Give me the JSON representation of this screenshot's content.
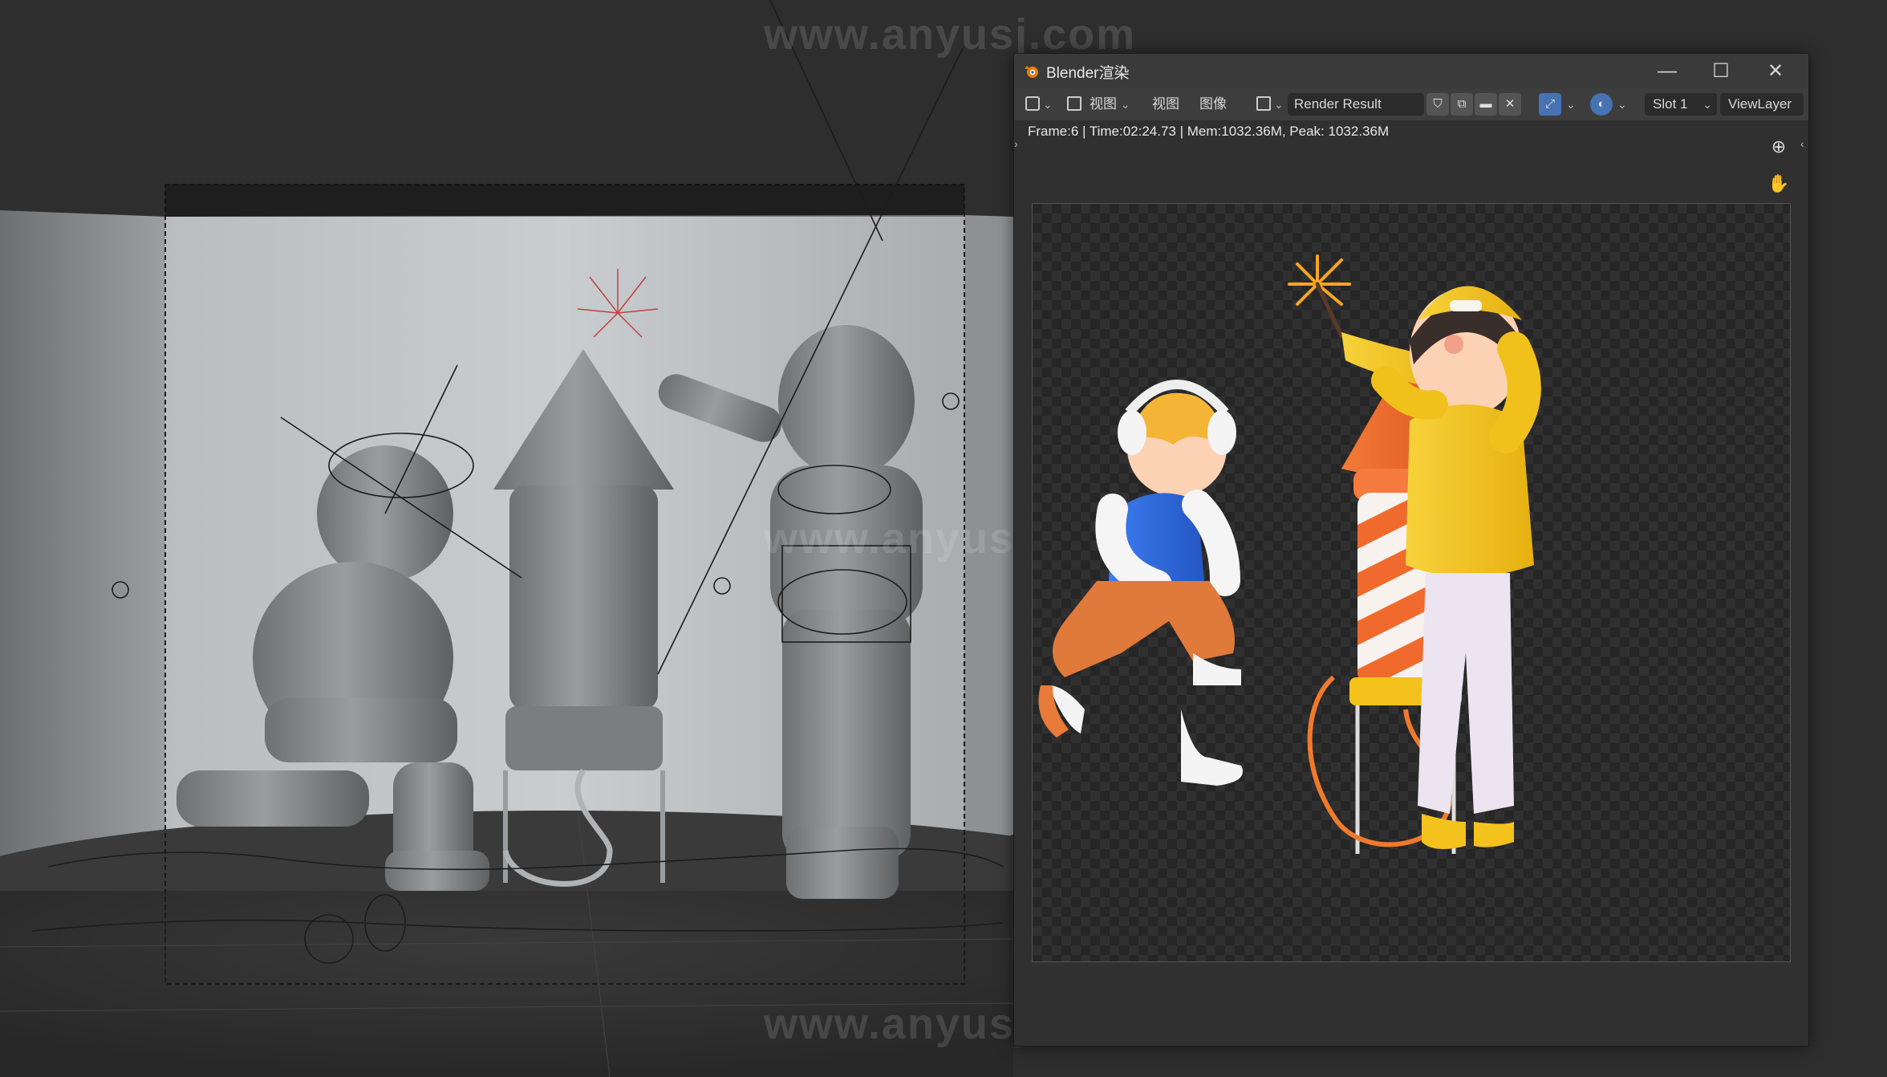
{
  "watermark": {
    "text": "www.anyusj.com"
  },
  "render_window": {
    "title": "Blender渲染",
    "controls": {
      "minimize": "—",
      "maximize": "☐",
      "close": "✕"
    },
    "toolbar": {
      "view_menu_label": "视图",
      "view_label": "视图",
      "image_label": "图像",
      "image_name": "Render Result",
      "slot_label": "Slot 1",
      "view_layer_label": "ViewLayer"
    },
    "status": "Frame:6 | Time:02:24.73 | Mem:1032.36M, Peak: 1032.36M"
  },
  "colors": {
    "accent_blue": "#4772b3",
    "rocket_orange": "#ef6a2c",
    "girl_yellow": "#f3c21d",
    "boy_blue": "#2f6bd8"
  },
  "icons": [
    "blender-logo-icon",
    "editor-type-icon",
    "image-icon",
    "shield-icon",
    "duplicate-icon",
    "folder-icon",
    "close-x-icon",
    "overlay-icon",
    "display-channel-icon",
    "zoom-icon",
    "hand-icon"
  ]
}
